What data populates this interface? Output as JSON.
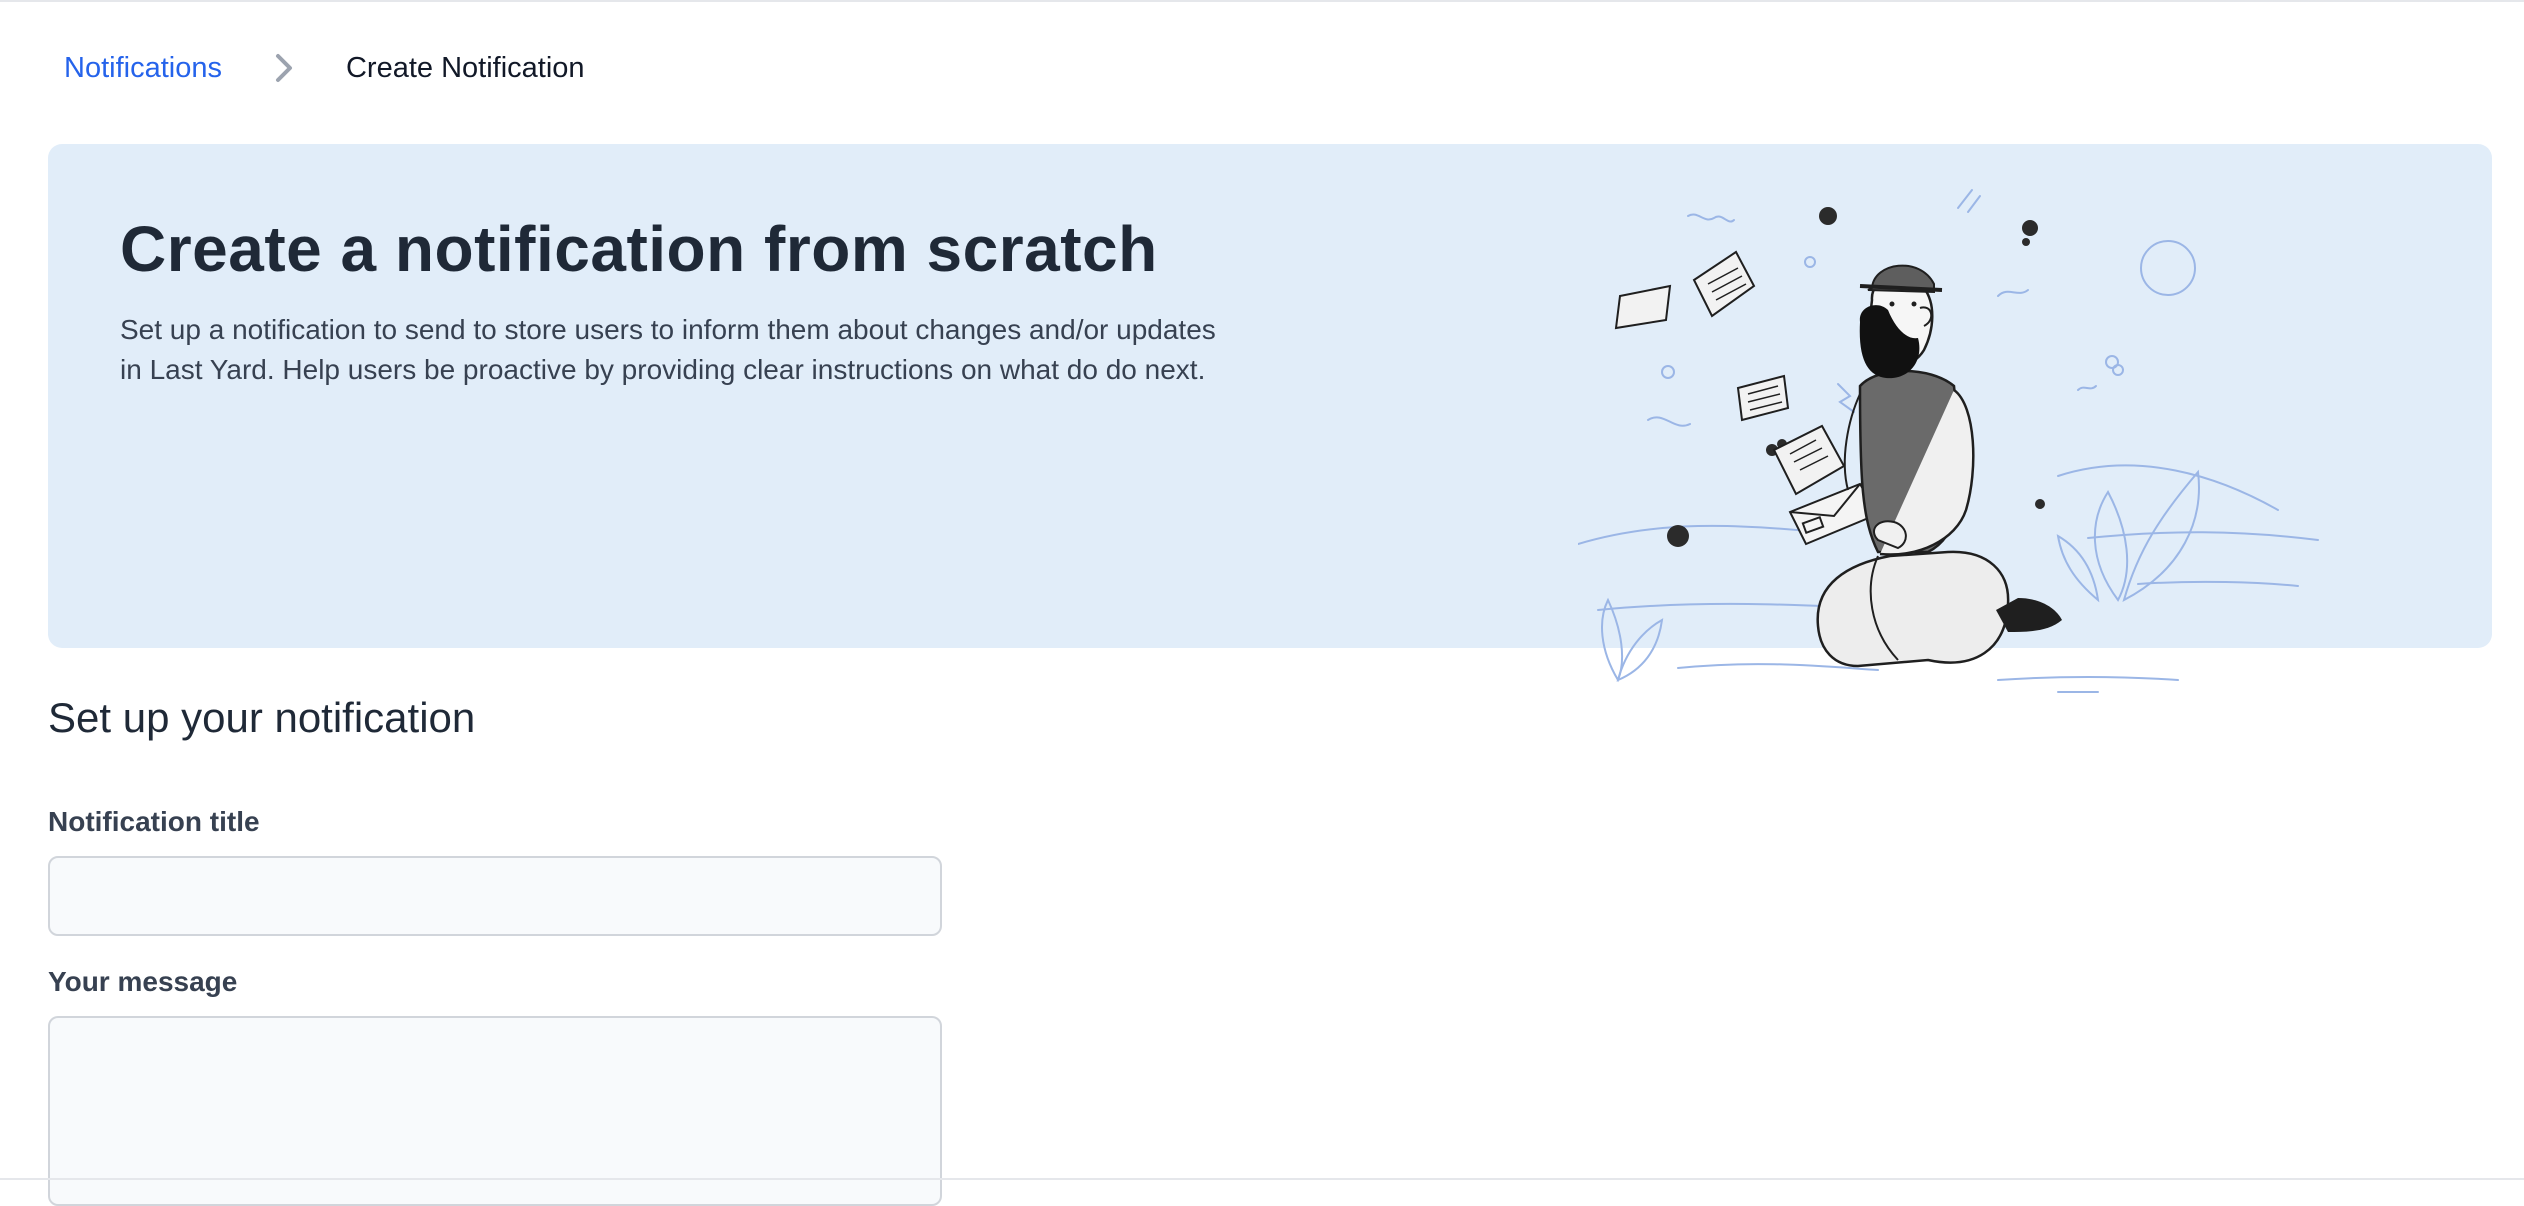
{
  "breadcrumb": {
    "parent": "Notifications",
    "current": "Create Notification"
  },
  "hero": {
    "title": "Create a notification from scratch",
    "description": "Set up a notification to send to store users to inform them about changes and/or updates in Last Yard. Help users be proactive by providing clear instructions on what do do next."
  },
  "form": {
    "section_title": "Set up your notification",
    "title_label": "Notification title",
    "title_value": "",
    "message_label": "Your message",
    "message_value": ""
  },
  "colors": {
    "link": "#2563eb",
    "hero_bg": "#e1edf9"
  },
  "icons": {
    "breadcrumb_separator": "chevron-right-icon",
    "hero_illustration": "man-reading-letters-illustration"
  }
}
